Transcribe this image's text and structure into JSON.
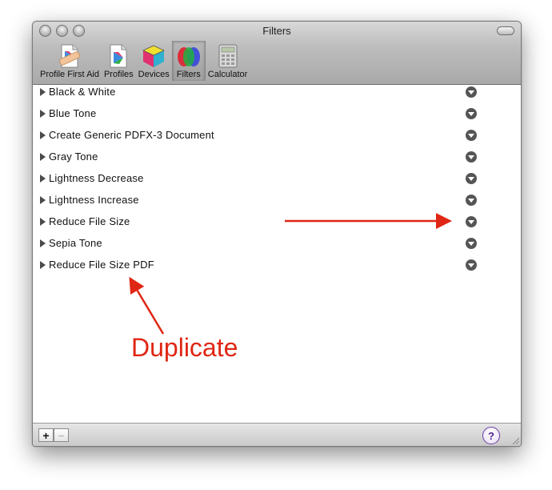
{
  "window": {
    "title": "Filters"
  },
  "toolbar": {
    "items": [
      {
        "label": "Profile First Aid",
        "icon": "first-aid-icon",
        "selected": false
      },
      {
        "label": "Profiles",
        "icon": "profiles-icon",
        "selected": false
      },
      {
        "label": "Devices",
        "icon": "devices-cube-icon",
        "selected": false
      },
      {
        "label": "Filters",
        "icon": "filters-icon",
        "selected": true
      },
      {
        "label": "Calculator",
        "icon": "calculator-icon",
        "selected": false
      }
    ]
  },
  "filters": [
    "Black & White",
    "Blue Tone",
    "Create Generic PDFX-3 Document",
    "Gray Tone",
    "Lightness Decrease",
    "Lightness Increase",
    "Reduce File Size",
    "Sepia Tone",
    "Reduce File Size PDF"
  ],
  "bottom": {
    "add": "+",
    "remove": "−",
    "help": "?"
  },
  "annotation": {
    "text": "Duplicate",
    "color": "#e02614"
  }
}
